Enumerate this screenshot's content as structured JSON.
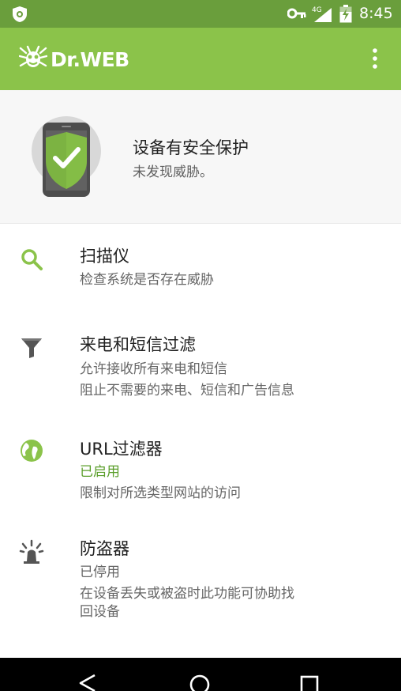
{
  "status_bar": {
    "time": "8:45",
    "network": "4G",
    "icons": [
      "app-badge-icon",
      "key-icon",
      "signal-icon",
      "battery-icon"
    ]
  },
  "app_bar": {
    "brand": "Dr.WEB",
    "icons": [
      "drweb-spider-logo-icon",
      "overflow-menu-icon"
    ],
    "color": "#8bc34a"
  },
  "protection_status": {
    "title": "设备有安全保护",
    "subtitle": "未发现威胁。",
    "icon": "shield-check-icon"
  },
  "menu": {
    "items": [
      {
        "icon": "search-icon",
        "title": "扫描仪",
        "lines": [
          "检查系统是否存在威胁"
        ]
      },
      {
        "icon": "filter-icon",
        "title": "来电和短信过滤",
        "lines": [
          "允许接收所有来电和短信",
          "阻止不需要的来电、短信和广告信息"
        ]
      },
      {
        "icon": "globe-icon",
        "title": "URL过滤器",
        "status": "已启用",
        "lines": [
          "限制对所选类型网站的访问"
        ]
      },
      {
        "icon": "alarm-beacon-icon",
        "title": "防盗器",
        "status": "已停用",
        "lines": [
          "在设备丢失或被盗时此功能可协助找",
          "回设备"
        ]
      }
    ]
  },
  "nav_bar": {
    "icons": [
      "back-icon",
      "home-icon",
      "recents-icon"
    ]
  },
  "colors": {
    "status_bar": "#6a9e3c",
    "app_bar": "#8bc34a",
    "accent_green": "#5a9e2a",
    "shield_green": "#7cb342"
  }
}
